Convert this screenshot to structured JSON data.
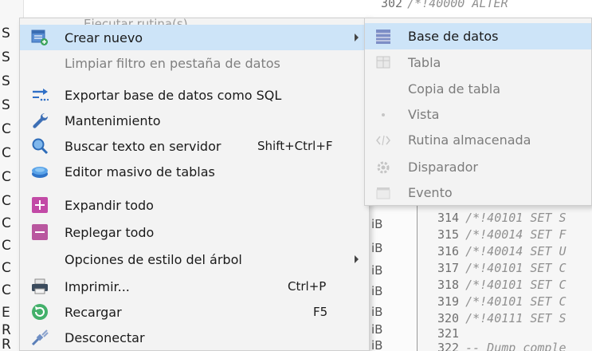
{
  "background": {
    "tree_letters": [
      "S",
      "S",
      "S",
      "S",
      "C",
      "C",
      "C",
      "C",
      "C",
      "C",
      "C",
      "C",
      "E",
      "R",
      "R"
    ],
    "size_units": [
      "iB",
      "iB",
      "iB",
      "iB",
      "iB",
      "iB",
      "iB"
    ],
    "sql_top": {
      "num": "302",
      "text": "/*!40000 ALTER"
    },
    "sql_lines": [
      {
        "num": "314",
        "text": "/*!40101 SET S"
      },
      {
        "num": "315",
        "text": "/*!40014 SET F"
      },
      {
        "num": "316",
        "text": "/*!40014 SET U"
      },
      {
        "num": "317",
        "text": "/*!40101 SET C"
      },
      {
        "num": "318",
        "text": "/*!40101 SET C"
      },
      {
        "num": "319",
        "text": "/*!40101 SET C"
      },
      {
        "num": "320",
        "text": "/*!40111 SET S"
      },
      {
        "num": "321",
        "text": ""
      },
      {
        "num": "322",
        "text": "-- Dump comple"
      }
    ]
  },
  "menu": {
    "partial_top": "Ejecutar rutina(s) ...",
    "items": [
      {
        "label": "Crear nuevo",
        "icon": "create-new-icon",
        "submenu": true,
        "highlighted": true
      },
      {
        "label": "Limpiar filtro en pestaña de datos",
        "disabled": true
      },
      {
        "label": "Exportar base de datos como SQL",
        "icon": "export-sql-icon"
      },
      {
        "label": "Mantenimiento",
        "icon": "wrench-icon"
      },
      {
        "label": "Buscar texto en servidor",
        "icon": "search-icon",
        "shortcut": "Shift+Ctrl+F"
      },
      {
        "label": "Editor masivo de tablas",
        "icon": "table-editor-icon"
      },
      {
        "label": "Expandir todo",
        "icon": "expand-icon"
      },
      {
        "label": "Replegar todo",
        "icon": "collapse-icon"
      },
      {
        "label": "Opciones de estilo del árbol",
        "submenu": true
      },
      {
        "label": "Imprimir...",
        "icon": "printer-icon",
        "shortcut": "Ctrl+P"
      },
      {
        "label": "Recargar",
        "icon": "reload-icon",
        "shortcut": "F5"
      },
      {
        "label": "Desconectar",
        "icon": "disconnect-icon"
      }
    ]
  },
  "submenu": {
    "items": [
      {
        "label": "Base de datos",
        "icon": "database-icon",
        "highlighted": true,
        "enabled": true
      },
      {
        "label": "Tabla",
        "icon": "table-icon"
      },
      {
        "label": "Copia de tabla",
        "icon": "table-copy-icon"
      },
      {
        "label": "Vista",
        "icon": "view-icon"
      },
      {
        "label": "Rutina almacenada",
        "icon": "routine-icon"
      },
      {
        "label": "Disparador",
        "icon": "trigger-icon"
      },
      {
        "label": "Evento",
        "icon": "event-icon"
      }
    ]
  },
  "colors": {
    "highlight": "#cde4f8",
    "menu_bg": "#f3f3f3",
    "disabled_text": "#7f7f7f",
    "expand": "#c24aa6",
    "collapse": "#b9579f"
  }
}
